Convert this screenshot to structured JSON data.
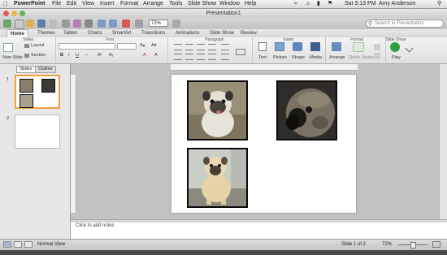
{
  "menubar": {
    "app_name": "PowerPoint",
    "items": [
      "File",
      "Edit",
      "View",
      "Insert",
      "Format",
      "Arrange",
      "Tools",
      "Slide Show",
      "Window",
      "Help"
    ],
    "clock": "Sat 5:13 PM",
    "user": "Amy Anderson"
  },
  "window": {
    "title": "Presentation1"
  },
  "toolbar": {
    "zoom": "72%",
    "search_placeholder": "Search in Presentation"
  },
  "ribbon": {
    "tabs": [
      "Home",
      "Themes",
      "Tables",
      "Charts",
      "SmartArt",
      "Transitions",
      "Animations",
      "Slide Show",
      "Review"
    ],
    "active_tab": "Home",
    "groups": {
      "slides": "Slides",
      "font": "Font",
      "paragraph": "Paragraph",
      "insert": "Insert",
      "format": "Format",
      "slide_show": "Slide Show"
    },
    "buttons": {
      "new_slide": "New Slide",
      "layout": "Layout",
      "section": "Section",
      "text": "Text",
      "picture": "Picture",
      "shape": "Shape",
      "media": "Media",
      "arrange": "Arrange",
      "quick_styles": "Quick Styles",
      "play": "Play"
    }
  },
  "sidepanel": {
    "tabs": [
      "Slides",
      "Outline"
    ],
    "active_tab": "Slides",
    "slide_numbers": [
      "1",
      "2"
    ]
  },
  "notes": {
    "placeholder": "Click to add notes"
  },
  "statusbar": {
    "view_name": "Normal View",
    "slide_indicator": "Slide 1 of 2",
    "zoom": "72%"
  },
  "colors": {
    "accent_selection": "#f0a040",
    "play_green": "#2e9e3e"
  }
}
